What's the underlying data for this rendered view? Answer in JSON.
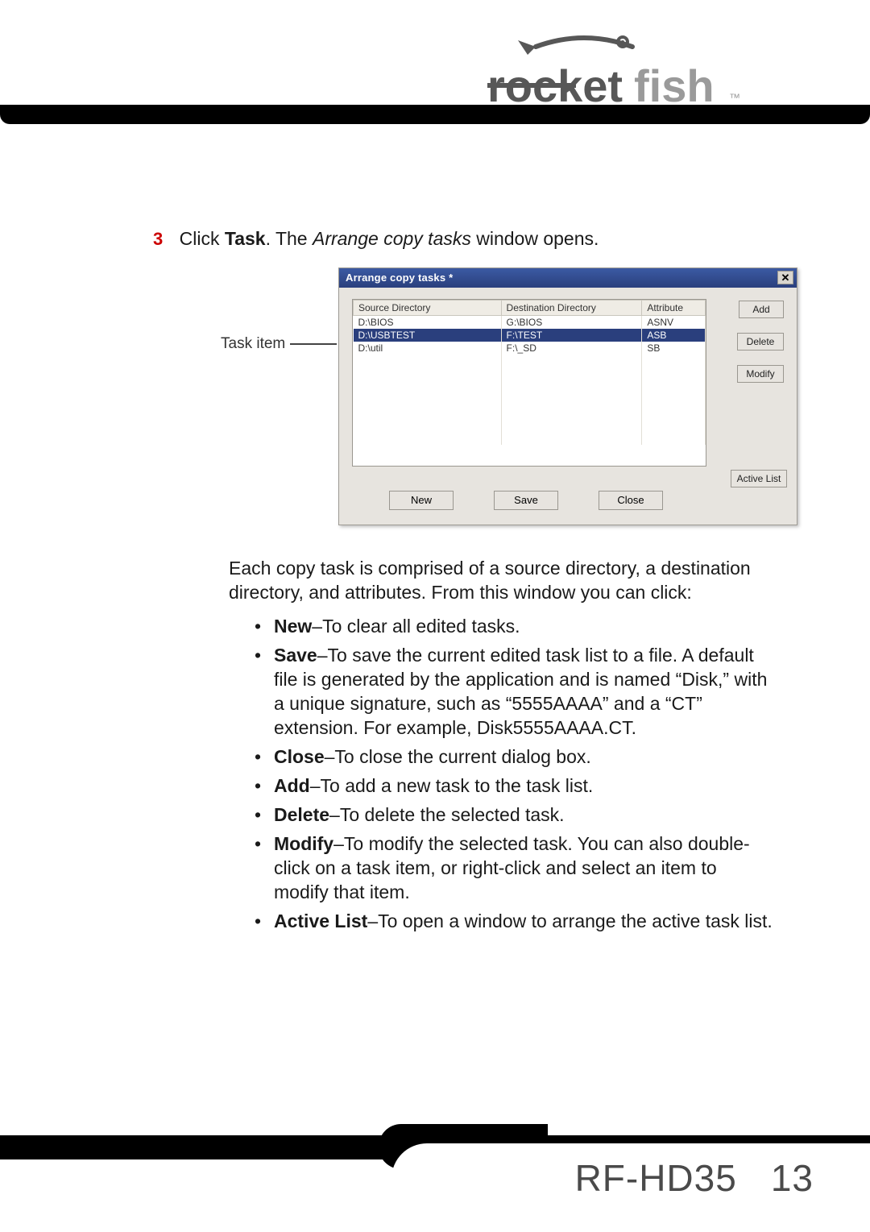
{
  "brand": "rocketfish",
  "step": {
    "number": "3",
    "prefix": "Click ",
    "bold": "Task",
    "mid": ". The ",
    "italic": "Arrange copy tasks",
    "suffix": " window opens."
  },
  "callout": {
    "label": "Task item"
  },
  "dialog": {
    "title": "Arrange copy tasks *",
    "close": "✕",
    "columns": {
      "src": "Source Directory",
      "dest": "Destination Directory",
      "attr": "Attribute"
    },
    "rows": [
      {
        "src": "D:\\BIOS",
        "dest": "G:\\BIOS",
        "attr": "ASNV"
      },
      {
        "src": "D:\\USBTEST",
        "dest": "F:\\TEST",
        "attr": "ASB"
      },
      {
        "src": "D:\\util",
        "dest": "F:\\_SD",
        "attr": "SB"
      }
    ],
    "selected_index": 1,
    "buttons": {
      "add": "Add",
      "delete": "Delete",
      "modify": "Modify",
      "active": "Active List",
      "new": "New",
      "save": "Save",
      "close": "Close"
    }
  },
  "intro": "Each copy task is comprised of a source directory, a destination directory, and attributes. From this window you can click:",
  "bullets": [
    {
      "lead": "New",
      "text": "–To clear all edited tasks."
    },
    {
      "lead": "Save",
      "text": "–To save the current edited task list to a file. A default file is generated by the application and is named “Disk,” with a unique signature, such as “5555AAAA” and a “CT” extension. For example, Disk5555AAAA.CT."
    },
    {
      "lead": "Close",
      "text": "–To close the current dialog box."
    },
    {
      "lead": "Add",
      "text": "–To add a new task to the task list."
    },
    {
      "lead": "Delete",
      "text": "–To delete the selected task."
    },
    {
      "lead": "Modify",
      "text": "–To modify the selected task. You can also double-click on a task item, or right-click and select an item to modify that item."
    },
    {
      "lead": "Active List",
      "text": "–To open a window to arrange the active task list."
    }
  ],
  "footer": {
    "model": "RF-HD35",
    "page": "13"
  }
}
